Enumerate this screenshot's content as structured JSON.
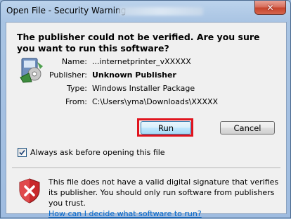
{
  "window": {
    "title": "Open File - Security Warning",
    "close_symbol": "✕"
  },
  "dialog": {
    "heading": "The publisher could not be verified.  Are you sure you want to run this software?",
    "fields": [
      {
        "label": "Name:",
        "value": "...internetprinter_vXXXXX",
        "bold": false
      },
      {
        "label": "Publisher:",
        "value": "Unknown Publisher",
        "bold": true
      },
      {
        "label": "Type:",
        "value": "Windows Installer Package",
        "bold": false
      },
      {
        "label": "From:",
        "value": "C:\\Users\\yma\\Downloads\\XXXXX",
        "bold": false
      }
    ],
    "run_label": "Run",
    "cancel_label": "Cancel",
    "checkbox_label": "Always ask before opening this file",
    "checkbox_checked": true,
    "warning_text": "This file does not have a valid digital signature that verifies its publisher.  You should only run software from publishers you trust.",
    "help_link": "How can I decide what software to run?"
  },
  "colors": {
    "highlight": "#e0141e",
    "link": "#0066cc"
  },
  "icons": {
    "package": "installer-package-icon",
    "shield": "red-shield-x-icon"
  }
}
